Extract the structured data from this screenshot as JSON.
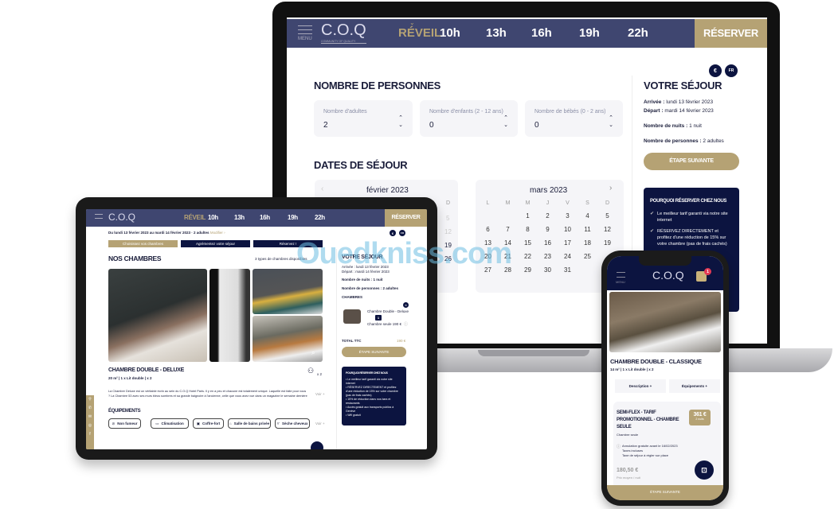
{
  "watermark": "Ouedkniss.com",
  "colors": {
    "nav": "#3f4670",
    "gold": "#b5a274",
    "navy": "#0c1440"
  },
  "brand": {
    "logo": "C.O.Q",
    "tagline": "COMMUNITY OF QUALITY",
    "menu": "MENU"
  },
  "nav": {
    "items": [
      "RÉVEIL",
      "10h",
      "13h",
      "16h",
      "19h",
      "22h"
    ],
    "reserve": "RÉSERVER"
  },
  "lang": {
    "currency": "€",
    "language": "FR"
  },
  "laptop": {
    "persons_title": "NOMBRE DE PERSONNES",
    "inputs": [
      {
        "label": "Nombre d'adultes",
        "value": "2"
      },
      {
        "label": "Nombre d'enfants (2 - 12 ans)",
        "value": "0"
      },
      {
        "label": "Nombre de bébés (0 - 2 ans)",
        "value": "0"
      }
    ],
    "dates_title": "DATES DE SÉJOUR",
    "cal_feb": {
      "title": "février 2023",
      "visible_header": "D",
      "visible_days": [
        "5",
        "12",
        "19",
        "26"
      ]
    },
    "cal_mar": {
      "title": "mars 2023",
      "headers": [
        "L",
        "M",
        "M",
        "J",
        "V",
        "S",
        "D"
      ],
      "weeks": [
        [
          "",
          "",
          "1",
          "2",
          "3",
          "4",
          "5"
        ],
        [
          "6",
          "7",
          "8",
          "9",
          "10",
          "11",
          "12"
        ],
        [
          "13",
          "14",
          "15",
          "16",
          "17",
          "18",
          "19"
        ],
        [
          "20",
          "21",
          "22",
          "23",
          "24",
          "25",
          ""
        ],
        [
          "27",
          "28",
          "29",
          "30",
          "31",
          "",
          ""
        ]
      ]
    },
    "stay": {
      "title": "VOTRE SÉJOUR",
      "arrival_label": "Arrivée :",
      "arrival": "lundi 13 février 2023",
      "departure_label": "Départ :",
      "departure": "mardi 14 février 2023",
      "nights_label": "Nombre de nuits :",
      "nights": "1 nuit",
      "persons_label": "Nombre de personnes :",
      "persons": "2 adultes",
      "next": "ÉTAPE SUIVANTE"
    },
    "why": {
      "title": "POURQUOI RÉSERVER CHEZ NOUS",
      "items": [
        "Le meilleur tarif garanti via notre site internet",
        "RÉSERVEZ DIRECTEMENT et profitez d'une réduction de 15% sur votre chambre (pas de frais cachés)"
      ]
    }
  },
  "tablet": {
    "summary": "Du lundi 13 février 2023 au mardi 14 février 2023 · 2 adultes",
    "modify": "Modifier ›",
    "steps": [
      "Choisissez vos chambres",
      "Agrémentez votre séjour",
      "Réservez !"
    ],
    "rooms_title": "NOS CHAMBRES",
    "rooms_count": "3 types de chambres disponibles",
    "room": {
      "name": "CHAMBRE DOUBLE - DELUXE",
      "specs": "20 m²  |  1 x Lit double  |  x 2",
      "capacity": "x 2",
      "description": "La Chambre Deluxe est un véritable écrin au sein du C.O.Q Hotel Paris. Il y en a peu et chacune est totalement unique. Laquelle est faite pour vous ? La Chambre 53 avec ses murs bleus sombres et sa grande baignoire à l'ancienne, celle que vous avez vue dans un magazine le semaine dernière ? Ou bien la 21, plus lumineuse avec",
      "more": "Voir +"
    },
    "equip_title": "ÉQUIPEMENTS",
    "equipment": [
      "Non fumeur",
      "Climatisation",
      "Coffre-fort",
      "Salle de bains privée",
      "Sèche cheveux"
    ],
    "equip_more": "Voir +",
    "stay": {
      "title": "VOTRE SÉJOUR",
      "arrival": "Arrivée : lundi 13 février 2023",
      "departure": "Départ : mardi 14 février 2023",
      "nights": "Nombre de nuits : 1 nuit",
      "persons": "Nombre de personnes : 2 adultes",
      "rooms_label": "CHAMBRES",
      "room_name": "Chambre Double - Deluxe",
      "qty": "1",
      "room_price": "Chambre seule 190 €",
      "total_label": "TOTAL TTC",
      "total": "190 €",
      "next": "ÉTAPE SUIVANTE"
    },
    "why": {
      "title": "POURQUOI RÉSERVER CHEZ NOUS",
      "items": [
        "Le meilleur tarif garanti via notre site internet",
        "RÉSERVEZ DIRECTEMENT et profitez d'une réduction de 15% sur votre chambre (pas de frais cachés)",
        "15% de réduction dans nos bars et restaurants",
        "Accès gratuit aux transports publics à Genève",
        "Wifi gratuit"
      ]
    }
  },
  "phone": {
    "cart_count": "1",
    "room": {
      "name": "CHAMBRE DOUBLE - CLASSIQUE",
      "specs": "14 m²  |  1 x Lit double  |  x 2"
    },
    "tabs": [
      "Description +",
      "Équipements +"
    ],
    "rate": {
      "name": "SEMI-FLEX - TARIF PROMOTIONNEL - CHAMBRE SEULE",
      "sub": "Chambre seule",
      "price": "361 €",
      "price_sub": "2 nuits",
      "conditions": [
        "Annulation gratuite avant le 16/02/2023",
        "Taxes incluses",
        "Taxe de séjour à régler sur place"
      ],
      "avg": "180,50 €",
      "avg_label": "Prix moyen / nuit"
    },
    "next": "ÉTAPE SUIVANTE"
  }
}
